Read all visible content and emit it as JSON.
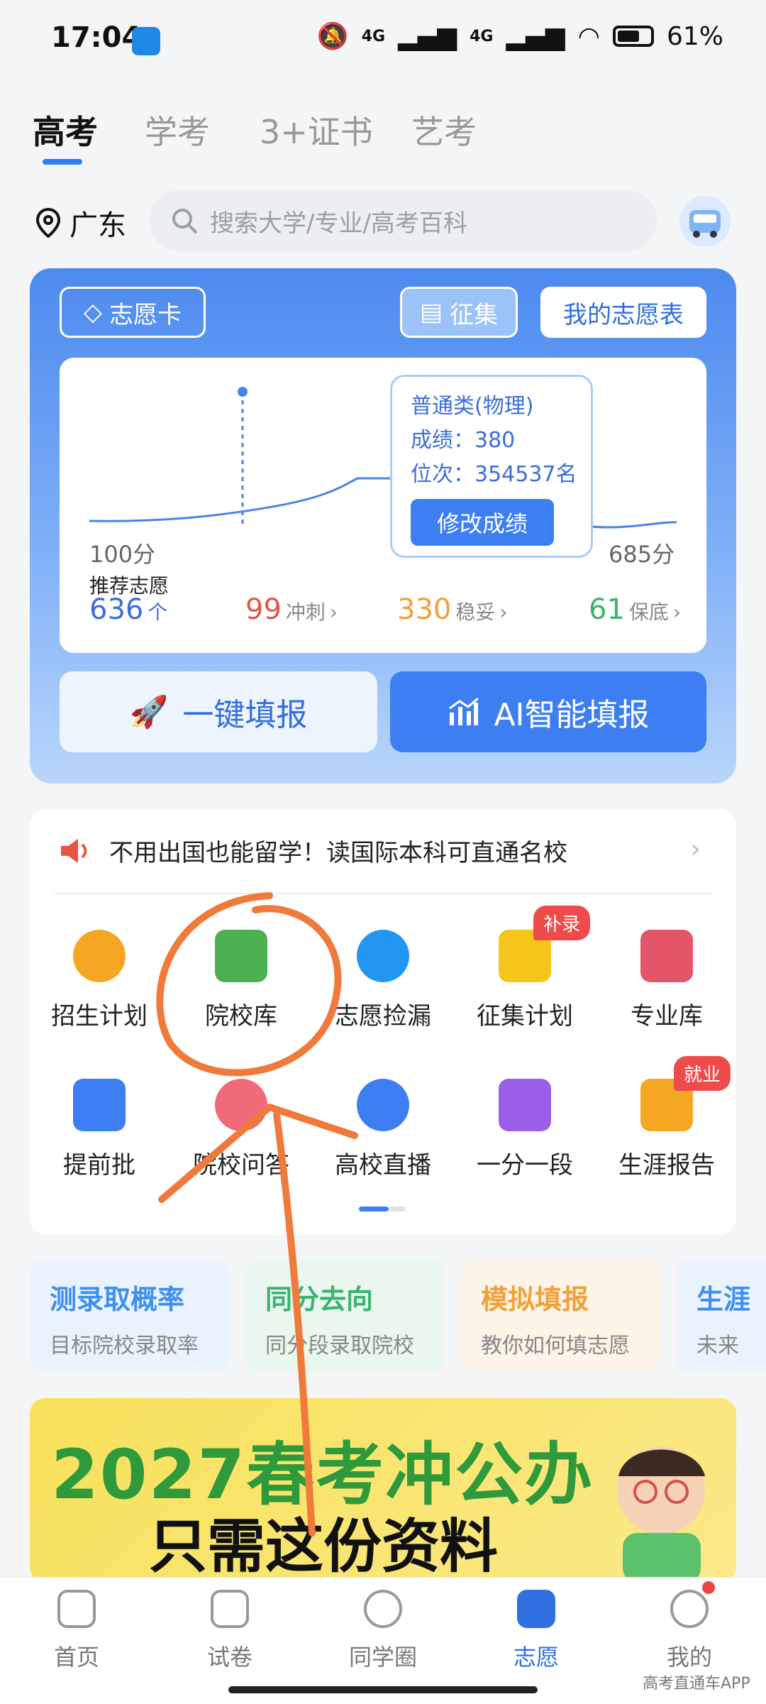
{
  "status_bar": {
    "time": "17:04",
    "network1": "4G",
    "network2": "4G",
    "battery": "61%"
  },
  "top_tabs": [
    {
      "label": "高考",
      "active": true
    },
    {
      "label": "学考",
      "active": false
    },
    {
      "label": "3+证书",
      "active": false
    },
    {
      "label": "艺考",
      "active": false
    }
  ],
  "location": "广东",
  "search": {
    "placeholder": "搜索大学/专业/高考百科"
  },
  "volunteer_card": {
    "card_label": "志愿卡",
    "collect_label": "征集",
    "my_table_label": "我的志愿表",
    "tooltip": {
      "category": "普通类(物理)",
      "score_label": "成绩：380",
      "rank_label": "位次：354537名",
      "modify_button": "修改成绩"
    },
    "score_min": "100分",
    "score_max": "685分",
    "recommend_label": "推荐志愿",
    "total": {
      "value": "636",
      "unit": "个"
    },
    "rush": {
      "value": "99",
      "label": "冲刺"
    },
    "stable": {
      "value": "330",
      "label": "稳妥"
    },
    "safe": {
      "value": "61",
      "label": "保底"
    },
    "one_click_label": "一键填报",
    "ai_label": "AI智能填报"
  },
  "notice": {
    "text": "不用出国也能留学！读国际本科可直通名校"
  },
  "grid": [
    {
      "label": "招生计划",
      "icon": "enrollment-plan-icon",
      "color": "#f5a623"
    },
    {
      "label": "院校库",
      "icon": "school-library-icon",
      "color": "#4caf50"
    },
    {
      "label": "志愿捡漏",
      "icon": "volunteer-leak-icon",
      "color": "#2196f3"
    },
    {
      "label": "征集计划",
      "icon": "collection-plan-icon",
      "color": "#f5c518",
      "badge": "补录"
    },
    {
      "label": "专业库",
      "icon": "major-library-icon",
      "color": "#e5556a"
    },
    {
      "label": "提前批",
      "icon": "early-batch-icon",
      "color": "#3d7ff3"
    },
    {
      "label": "院校问答",
      "icon": "school-qa-icon",
      "color": "#f06b7a"
    },
    {
      "label": "高校直播",
      "icon": "live-stream-icon",
      "color": "#3d7ff3"
    },
    {
      "label": "一分一段",
      "icon": "score-segment-icon",
      "color": "#9c5de8"
    },
    {
      "label": "生涯报告",
      "icon": "career-report-icon",
      "color": "#f5a623",
      "badge": "就业"
    }
  ],
  "features": [
    {
      "title": "测录取概率",
      "subtitle": "目标院校录取率",
      "color": "#3d8ff0",
      "bg": "#eaf3fd"
    },
    {
      "title": "同分去向",
      "subtitle": "同分段录取院校",
      "color": "#3cb371",
      "bg": "#e9f7ee"
    },
    {
      "title": "模拟填报",
      "subtitle": "教你如何填志愿",
      "color": "#f0a23a",
      "bg": "#fdf3e6"
    },
    {
      "title": "生涯",
      "subtitle": "未来",
      "color": "#3d8ff0",
      "bg": "#eaf3fd"
    }
  ],
  "banner": {
    "line1": "2027春考冲公办",
    "line2": "只需这份资料"
  },
  "bottom_nav": [
    {
      "label": "首页",
      "active": false
    },
    {
      "label": "试卷",
      "active": false
    },
    {
      "label": "同学圈",
      "active": false
    },
    {
      "label": "志愿",
      "active": true
    },
    {
      "label": "我的",
      "active": false
    }
  ],
  "watermark": "高考直通车APP",
  "annotation_color": "#f07a3c"
}
